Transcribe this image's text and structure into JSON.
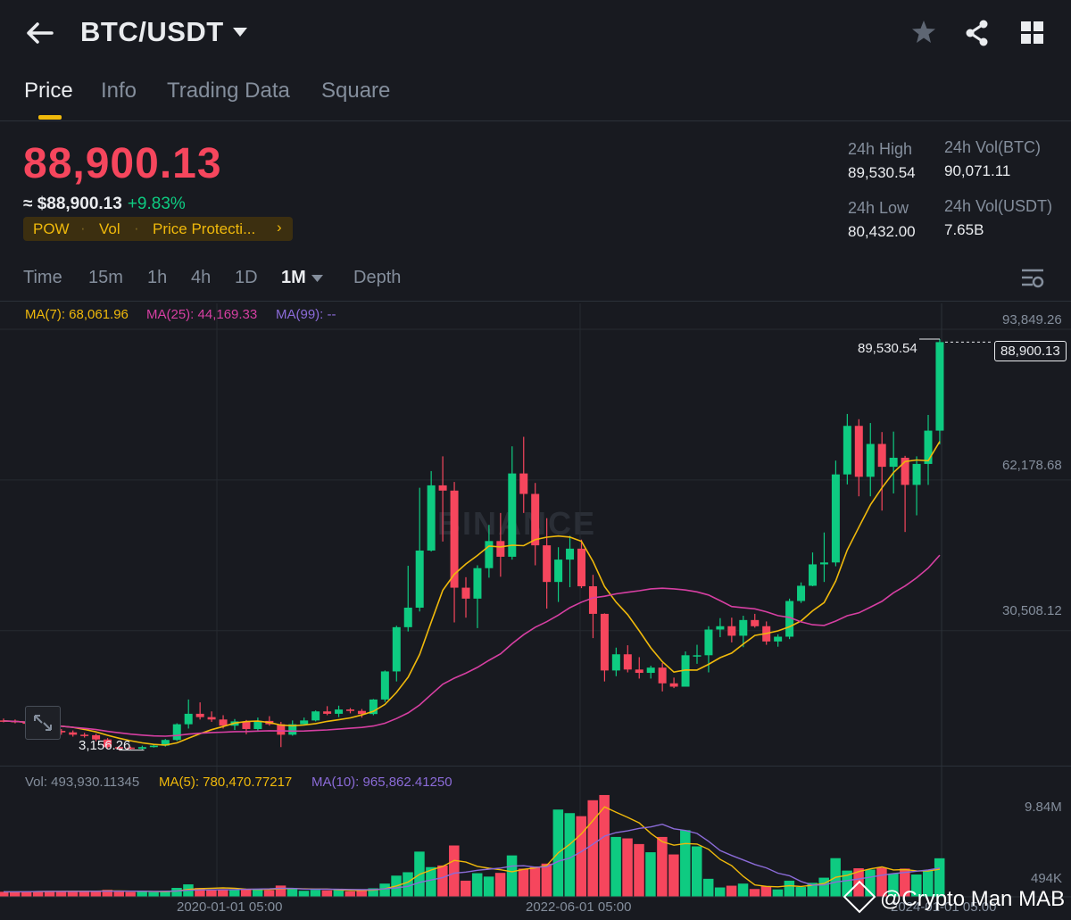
{
  "header": {
    "back_icon": "arrow-left-icon",
    "pair": "BTC/USDT",
    "caret_icon": "caret-down-icon",
    "star_icon": "star-icon",
    "share_icon": "share-icon",
    "grid_icon": "grid-icon"
  },
  "tabs": [
    "Price",
    "Info",
    "Trading Data",
    "Square"
  ],
  "ticker": {
    "last_price": "88,900.13",
    "approx": "≈ $88,900.13",
    "change": "+9.83%",
    "chips": [
      "POW",
      "Vol",
      "Price Protecti...",
      "›"
    ],
    "high_label": "24h High",
    "high": "89,530.54",
    "low_label": "24h Low",
    "low": "80,432.00",
    "vol_btc_label": "24h Vol(BTC)",
    "vol_btc": "90,071.11",
    "vol_usdt_label": "24h Vol(USDT)",
    "vol_usdt": "7.65B"
  },
  "timeframes": [
    "Time",
    "15m",
    "1h",
    "4h",
    "1D",
    "1M",
    "Depth"
  ],
  "active_timeframe": "1M",
  "indicators": {
    "ma7": "MA(7): 68,061.96",
    "ma25": "MA(25): 44,169.33",
    "ma99": "MA(99): --"
  },
  "price_axis": [
    "93,849.26",
    "62,178.68",
    "30,508.12"
  ],
  "annotations": {
    "high_marker": "89,530.54",
    "last_marker": "88,900.13",
    "low_marker": "3,156.26"
  },
  "volume_legend": {
    "vol": "Vol: 493,930.11345",
    "ma5": "MA(5): 780,470.77217",
    "ma10": "MA(10): 965,862.41250"
  },
  "volume_axis": [
    "9.84M",
    "494K"
  ],
  "time_axis": [
    "2020-01-01 05:00",
    "2022-06-01 05:00",
    "2024-01-01 05:00"
  ],
  "watermark": "BINANCE",
  "credit": "@Crypto Man MAB",
  "colors": {
    "up": "#0ecb81",
    "down": "#f6465d",
    "ma7": "#f0b90b",
    "ma25": "#d63fa2",
    "ma99": "#8b6bd8",
    "accent": "#f0b90b",
    "bg": "#181a20"
  },
  "chart_data": {
    "type": "candlestick",
    "interval": "1M",
    "ylim": [
      0,
      93849.26
    ],
    "y_ticks": [
      93849.26,
      62178.68,
      30508.12
    ],
    "candles": [
      [
        9400,
        9300,
        9800,
        9000
      ],
      [
        9300,
        9100,
        9600,
        8800
      ],
      [
        9100,
        8700,
        9400,
        8300
      ],
      [
        8700,
        8000,
        9000,
        7600
      ],
      [
        8000,
        7200,
        8300,
        6800
      ],
      [
        7200,
        6900,
        7600,
        6400
      ],
      [
        6900,
        6400,
        7300,
        6000
      ],
      [
        6400,
        6300,
        6800,
        5800
      ],
      [
        6300,
        5400,
        6600,
        5000
      ],
      [
        5400,
        3800,
        5700,
        3400
      ],
      [
        3800,
        3700,
        4000,
        3156.26
      ],
      [
        3700,
        3450,
        3900,
        3300
      ],
      [
        3450,
        3800,
        4100,
        3300
      ],
      [
        3800,
        4100,
        4300,
        3700
      ],
      [
        4100,
        5300,
        5500,
        3900
      ],
      [
        5300,
        8600,
        8800,
        5100
      ],
      [
        8600,
        10800,
        13800,
        7700
      ],
      [
        10800,
        10100,
        13200,
        9600
      ],
      [
        10100,
        9600,
        11300,
        9100
      ],
      [
        9600,
        8300,
        10500,
        7700
      ],
      [
        8300,
        9200,
        9700,
        7400
      ],
      [
        9200,
        7600,
        9500,
        6500
      ],
      [
        7600,
        9300,
        10000,
        7200
      ],
      [
        9300,
        8600,
        10300,
        8300
      ],
      [
        8600,
        6400,
        9100,
        3800
      ],
      [
        6400,
        8600,
        9400,
        6200
      ],
      [
        8600,
        9400,
        10000,
        8400
      ],
      [
        9400,
        11300,
        11500,
        9200
      ],
      [
        11300,
        10800,
        12400,
        10500
      ],
      [
        10800,
        11700,
        12500,
        10100
      ],
      [
        11700,
        11400,
        12000,
        10900
      ],
      [
        11400,
        10750,
        11800,
        10000
      ],
      [
        10750,
        13800,
        13900,
        10500
      ],
      [
        13800,
        19700,
        19900,
        13300
      ],
      [
        19700,
        29000,
        29300,
        17600
      ],
      [
        29000,
        33100,
        41900,
        28100
      ],
      [
        33100,
        45100,
        58300,
        32300
      ],
      [
        45100,
        58800,
        61800,
        44900
      ],
      [
        58800,
        57700,
        64900,
        47000
      ],
      [
        57700,
        37300,
        59500,
        30000
      ],
      [
        37300,
        35000,
        39500,
        31000
      ],
      [
        35000,
        41400,
        42000,
        28800
      ],
      [
        41400,
        47100,
        50500,
        39400
      ],
      [
        47100,
        43800,
        53000,
        39600
      ],
      [
        43800,
        61300,
        67000,
        43200
      ],
      [
        61300,
        57000,
        69000,
        53000
      ],
      [
        57000,
        46200,
        59300,
        42000
      ],
      [
        46200,
        38500,
        51900,
        32900
      ],
      [
        38500,
        43200,
        45800,
        34300
      ],
      [
        43200,
        45500,
        48200,
        37400
      ],
      [
        45500,
        37600,
        47400,
        37200
      ],
      [
        37600,
        31800,
        40000,
        26700
      ],
      [
        31800,
        19900,
        31900,
        17600
      ],
      [
        19900,
        23300,
        24700,
        18700
      ],
      [
        23300,
        20100,
        25200,
        19500
      ],
      [
        20100,
        19400,
        22700,
        18200
      ],
      [
        19400,
        20500,
        20900,
        18200
      ],
      [
        20500,
        17200,
        21500,
        15500
      ],
      [
        17200,
        16500,
        18400,
        16200
      ],
      [
        16500,
        23100,
        23900,
        16500
      ],
      [
        23100,
        23100,
        25300,
        21300
      ],
      [
        23100,
        28500,
        29200,
        19500
      ],
      [
        28500,
        29200,
        30900,
        26900
      ],
      [
        29200,
        27200,
        31000,
        25800
      ],
      [
        27200,
        30500,
        31400,
        24800
      ],
      [
        30500,
        29200,
        31800,
        28900
      ],
      [
        29200,
        26000,
        30200,
        25300
      ],
      [
        26000,
        27000,
        27500,
        24900
      ],
      [
        27000,
        34500,
        35000,
        26500
      ],
      [
        34500,
        37700,
        38400,
        34100
      ],
      [
        37700,
        42200,
        44700,
        37600
      ],
      [
        42200,
        42600,
        48900,
        38500
      ],
      [
        42600,
        61100,
        64000,
        41800
      ],
      [
        61100,
        71300,
        73800,
        59000
      ],
      [
        71300,
        60600,
        72700,
        56500
      ],
      [
        60600,
        67500,
        71900,
        56500
      ],
      [
        67500,
        62700,
        70000,
        53500
      ],
      [
        62700,
        64600,
        70100,
        57100
      ],
      [
        64600,
        58900,
        65000,
        49000
      ],
      [
        58900,
        63300,
        64900,
        52500
      ],
      [
        63300,
        70300,
        73600,
        58900
      ],
      [
        70300,
        88900.13,
        89530.54,
        67400
      ]
    ],
    "volume_axis": [
      "9.84M",
      "494K"
    ]
  }
}
